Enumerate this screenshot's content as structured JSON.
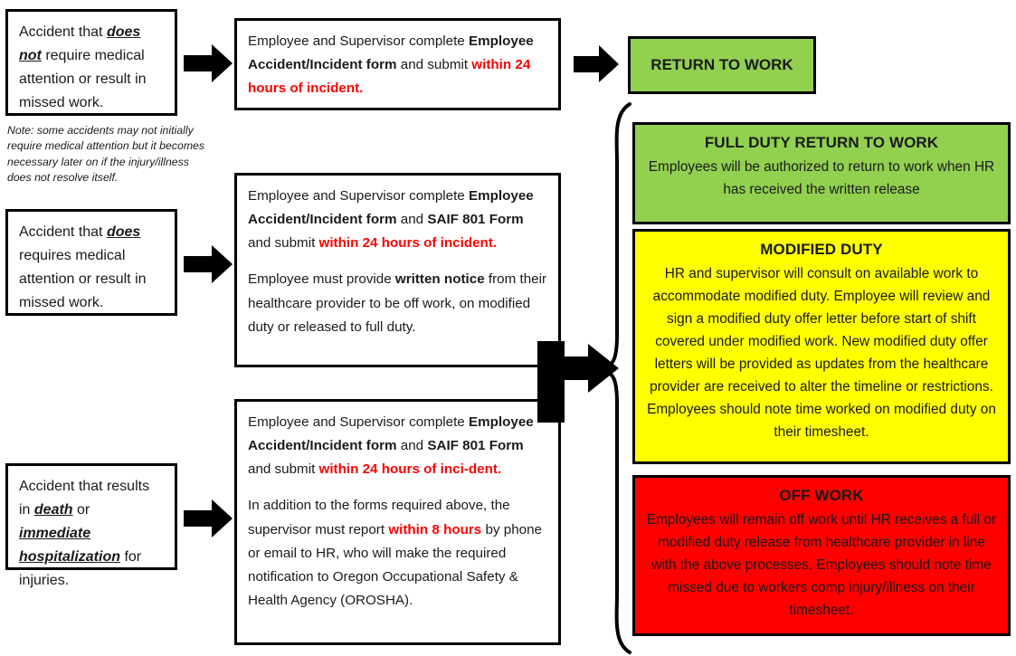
{
  "colors": {
    "green": "#92D050",
    "yellow": "#FFFF00",
    "red": "#FF0000",
    "black": "#000000",
    "accent_red_text": "#FF0000"
  },
  "triggers": [
    {
      "id": "no-medical",
      "line1_a": "Accident that ",
      "line1_em": "does",
      "line2_em": "not",
      "line2_b": " require medical attention or result in missed work."
    },
    {
      "id": "does-require-medical",
      "line1_a": "Accident that ",
      "line1_em": "does",
      "line2_b": "requires medical attention or result in missed work."
    },
    {
      "id": "death-or-hospitalization",
      "seg1": "Accident that results in ",
      "em1": "death",
      "seg2": " or ",
      "em2": "immediate hospitalization",
      "seg3": " for injuries."
    }
  ],
  "note": "Note: some accidents may not initially require medical attention but it becomes necessary later on if the injury/illness does not resolve itself.",
  "processes": [
    {
      "id": "proc-minor",
      "p1": [
        {
          "t": "Employee and Supervisor complete ",
          "s": "n"
        },
        {
          "t": "Employee Accident/Incident form",
          "s": "b"
        },
        {
          "t": " and submit ",
          "s": "n"
        },
        {
          "t": "within 24 hours of incident.",
          "s": "r"
        }
      ]
    },
    {
      "id": "proc-medical",
      "p1": [
        {
          "t": "Employee and Supervisor complete ",
          "s": "n"
        },
        {
          "t": "Employee Accident/Incident form",
          "s": "b"
        },
        {
          "t": " and ",
          "s": "n"
        },
        {
          "t": "SAIF 801 Form",
          "s": "b"
        },
        {
          "t": " and submit ",
          "s": "n"
        },
        {
          "t": "within 24 hours of incident.",
          "s": "r"
        }
      ],
      "p2": [
        {
          "t": "Employee must provide ",
          "s": "n"
        },
        {
          "t": "written notice",
          "s": "b"
        },
        {
          "t": " from their healthcare provider to be off work, on modified duty or released to full duty.",
          "s": "n"
        }
      ]
    },
    {
      "id": "proc-severe",
      "p1": [
        {
          "t": "Employee and Supervisor complete ",
          "s": "n"
        },
        {
          "t": "Employee Accident/Incident form",
          "s": "b"
        },
        {
          "t": " and ",
          "s": "n"
        },
        {
          "t": "SAIF 801 Form",
          "s": "b"
        },
        {
          "t": " and submit ",
          "s": "n"
        },
        {
          "t": "within 24 hours of inci-dent.",
          "s": "r"
        }
      ],
      "p2": [
        {
          "t": "In addition to the forms required above, the supervisor must report ",
          "s": "n"
        },
        {
          "t": "within 8 hours",
          "s": "r"
        },
        {
          "t": " by phone or email to HR, who will make the required notification to Oregon Occupational Safety & Health Agency (OROSHA).",
          "s": "n"
        }
      ]
    }
  ],
  "outcomes": {
    "return_to_work": {
      "label": "RETURN TO WORK",
      "color": "#92D050"
    },
    "full_duty": {
      "title": "FULL DUTY RETURN TO WORK",
      "body": "Employees will be authorized to return to work when HR has received the written release",
      "color": "#92D050"
    },
    "modified_duty": {
      "title": "MODIFIED DUTY",
      "body": "HR and supervisor will consult on available work to accommodate modified duty. Employee will review and sign a modified duty offer letter before start of shift covered under modified work. New modified duty offer letters will be provided as updates from the healthcare provider are received to alter the timeline or restrictions.  Employees should note time worked on modified duty on their timesheet.",
      "color": "#FFFF00"
    },
    "off_work": {
      "title": "OFF WORK",
      "body": "Employees will remain off work until HR receives a full or modified duty release from healthcare provider in line with the above processes. Employees should note time missed due to workers comp  injury/illness on their timesheet.",
      "color": "#FF0000"
    }
  },
  "connectors": {
    "arrow1": "right-arrow",
    "arrow2": "right-arrow",
    "arrow3": "right-arrow",
    "arrow4": "right-arrow",
    "bent_arrow": "bent-right-arrow",
    "brace": "right-curly-brace"
  }
}
